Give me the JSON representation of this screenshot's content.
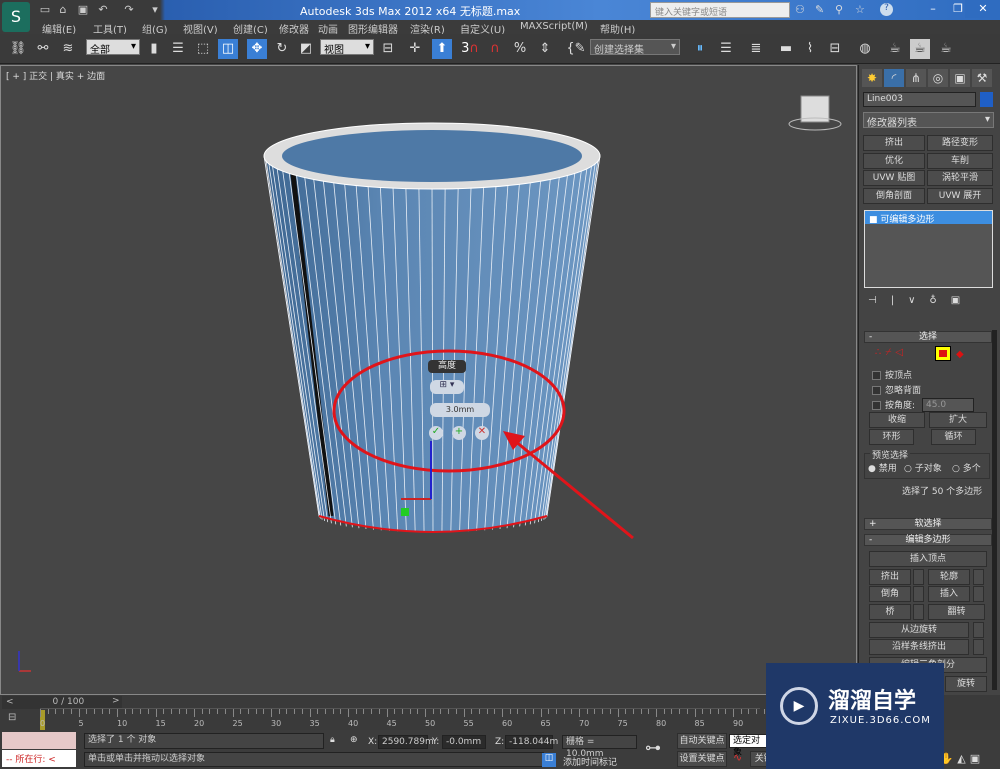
{
  "app": {
    "title": "Autodesk 3ds Max  2012 x64   无标题.max",
    "search_placeholder": "键入关键字或短语",
    "logo_text": "S"
  },
  "menu": [
    "编辑(E)",
    "工具(T)",
    "组(G)",
    "视图(V)",
    "创建(C)",
    "修改器",
    "动画",
    "图形编辑器",
    "渲染(R)",
    "自定义(U)",
    "MAXScript(M)",
    "帮助(H)"
  ],
  "toolbar": {
    "filter": "全部",
    "ref_coord": "视图",
    "selection_set": "创建选择集",
    "snap_label": "3"
  },
  "viewport": {
    "label": "[ + ] 正交 | 真实 + 边面",
    "caddy": {
      "title": "高度",
      "value": "3.0mm"
    },
    "annotation_color": "#e0141a",
    "mesh_color": "#5b86b3"
  },
  "panel": {
    "object_name": "Line003",
    "object_color": "#1f5fc6",
    "modifier_list": "修改器列表",
    "mod_buttons": [
      "挤出",
      "路径变形",
      "优化",
      "车削",
      "UVW 贴图",
      "涡轮平滑",
      "倒角剖面",
      "UVW 展开"
    ],
    "stack": [
      "可编辑多边形"
    ],
    "selection": {
      "title": "选择",
      "by_vertex": "按顶点",
      "ignore_backface": "忽略背面",
      "by_angle": "按角度:",
      "angle": "45.0",
      "shrink": "收缩",
      "grow": "扩大",
      "ring": "环形",
      "loop": "循环",
      "preview_title": "预览选择",
      "preview_options": [
        "禁用",
        "子对象",
        "多个"
      ],
      "status": "选择了 50 个多边形"
    },
    "soft_selection": "软选择",
    "edit_poly": {
      "title": "编辑多边形",
      "insert_vertex": "插入顶点",
      "buttons": [
        "挤出",
        "轮廓",
        "倒角",
        "插入",
        "桥",
        "翻转"
      ],
      "hinge": "从边旋转",
      "extrude_spline": "沿样条线挤出",
      "edit_tri": "编辑三角剖分",
      "turn": "旋转"
    }
  },
  "timeline": {
    "frame": "0 / 100",
    "ticks": [
      "0",
      "5",
      "10",
      "15",
      "20",
      "25",
      "30",
      "35",
      "40",
      "45",
      "50",
      "55",
      "60",
      "65",
      "70",
      "75",
      "80",
      "85",
      "90"
    ]
  },
  "status": {
    "script_prompt": "所在行:",
    "selected": "选择了 1 个 对象",
    "hint": "单击或单击并拖动以选择对象",
    "x": "2590.789m",
    "y": "-0.0mm",
    "z": "-118.044m",
    "grid": "栅格 = 10.0mm",
    "add_tag": "添加时间标记",
    "auto_key": "自动关键点",
    "set_key": "设置关键点",
    "selected_obj": "选定对象",
    "key_filter": "关键点过滤器...",
    "frame": "0"
  },
  "watermark": {
    "name": "溜溜自学",
    "url": "ZIXUE.3D66.COM"
  }
}
